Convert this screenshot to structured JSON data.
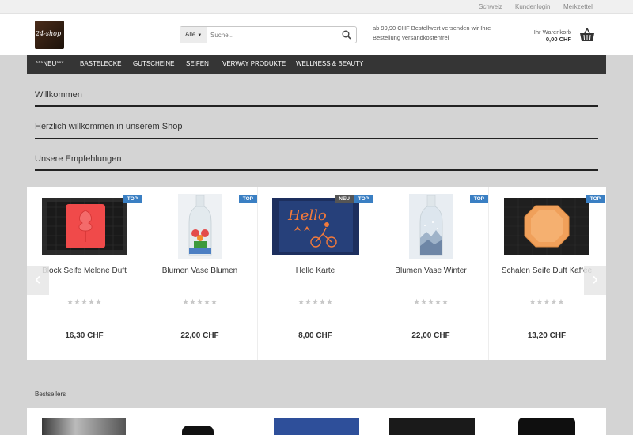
{
  "topbar": {
    "country": "Schweiz",
    "login": "Kundenlogin",
    "wishlist": "Merkzettel"
  },
  "logo": {
    "text": "24-shop"
  },
  "search": {
    "category": "Alle",
    "placeholder": "Suche..."
  },
  "shipping_note": "ab 99,90 CHF Bestellwert versenden wir Ihre Bestellung versandkostenfrei",
  "cart": {
    "title": "Ihr Warenkorb",
    "value": "0,00 CHF"
  },
  "nav": [
    "***NEU***",
    "Bastelecke",
    "Gutscheine",
    "Seifen",
    "Verway Produkte",
    "Wellness & Beauty"
  ],
  "sections": {
    "welcome": "Willkommen",
    "greeting": "Herzlich willkommen in unserem Shop",
    "recommendations": "Unsere Empfehlungen"
  },
  "stars": "★★★★★",
  "products": [
    {
      "name": "Block Seife Melone Duft",
      "price": "16,30 CHF",
      "badges": [
        "TOP"
      ]
    },
    {
      "name": "Blumen Vase Blumen",
      "price": "22,00 CHF",
      "badges": [
        "TOP"
      ]
    },
    {
      "name": "Hello Karte",
      "price": "8,00 CHF",
      "badges": [
        "NEU",
        "TOP"
      ],
      "card_text": "Hello"
    },
    {
      "name": "Blumen Vase Winter",
      "price": "22,00 CHF",
      "badges": [
        "TOP"
      ]
    },
    {
      "name": "Schalen Seife Duft Kaffee",
      "price": "13,20 CHF",
      "badges": [
        "TOP"
      ]
    }
  ],
  "slider_prev": "‹",
  "slider_next": "›",
  "bestsellers": {
    "label": "Bestsellers"
  }
}
